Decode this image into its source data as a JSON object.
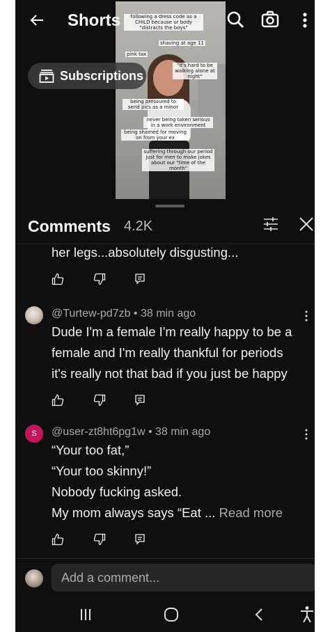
{
  "header": {
    "title": "Shorts",
    "subscriptions_label": "Subscriptions"
  },
  "video": {
    "captions": [
      "following a dress code as a CHILD because ur body \"distracts the boys\"",
      "shaving at age 11",
      "pink tax",
      "\"it's hard to be walking alone at night\"",
      "being pressured to send pics as a minor",
      "never being taken serious in a work environment",
      "being shamed for moving on from your ex",
      "suffering through our period just for men to make jokes about our \"time of the month\""
    ]
  },
  "comments_panel": {
    "title": "Comments",
    "count": "4.2K",
    "comments": [
      {
        "partial_text": "her legs...absolutely disgusting..."
      },
      {
        "handle": "@Turtew-pd7zb",
        "time": "38 min ago",
        "lines": [
          "Dude I'm a female I'm really happy to be a",
          "female and I'm really thankful for periods",
          "it's really not that bad if you just be happy"
        ]
      },
      {
        "avatar_letter": "S",
        "handle": "@user-zt8ht6pg1w",
        "time": "38 min ago",
        "lines": [
          "“Your too fat,”",
          "“Your too skinny!”",
          "Nobody fucking asked.",
          "My mom always says “Eat ..."
        ],
        "read_more": "Read more"
      }
    ],
    "separator": "•"
  },
  "composer": {
    "placeholder": "Add a comment..."
  },
  "colors": {
    "background": "#0f0f0f",
    "text_primary": "#f1f1f1",
    "text_secondary": "#aaaaaa",
    "avatar_s": "#c2185b",
    "input_bg": "#272727"
  },
  "icons": {
    "back": "arrow-left-icon",
    "search": "search-icon",
    "camera": "camera-icon",
    "more": "more-vertical-icon",
    "filter": "sliders-icon",
    "close": "close-icon",
    "like": "thumbs-up-icon",
    "dislike": "thumbs-down-icon",
    "reply": "reply-icon",
    "subscriptions": "subscriptions-icon"
  }
}
